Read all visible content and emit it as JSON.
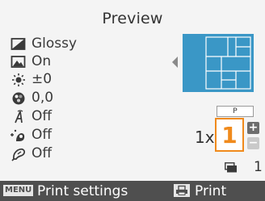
{
  "screen": {
    "title": "Preview"
  },
  "settings": [
    {
      "name": "paper-finish",
      "icon": "paper-finish-icon",
      "value": "Glossy"
    },
    {
      "name": "borders",
      "icon": "image-border-icon",
      "value": "On"
    },
    {
      "name": "brightness",
      "icon": "brightness-icon",
      "value": "±0"
    },
    {
      "name": "color-adjust",
      "icon": "color-adjust-icon",
      "value": "0,0"
    },
    {
      "name": "date-print",
      "icon": "date-print-icon",
      "value": "Off"
    },
    {
      "name": "red-eye",
      "icon": "red-eye-correction-icon",
      "value": "Off"
    },
    {
      "name": "my-colors",
      "icon": "my-colors-icon",
      "value": "Off"
    }
  ],
  "layout": {
    "paper_size": "P"
  },
  "copies": {
    "prefix": "1x",
    "value": "1"
  },
  "sheets": {
    "count": "1"
  },
  "footer": {
    "left_key": "MENU",
    "left_label": "Print settings",
    "right_label": "Print"
  },
  "colors": {
    "accent": "#f08a1c",
    "thumbnail": "#3a97c6",
    "footer_bg": "#4f4f4f",
    "background": "#f4f4f4"
  }
}
